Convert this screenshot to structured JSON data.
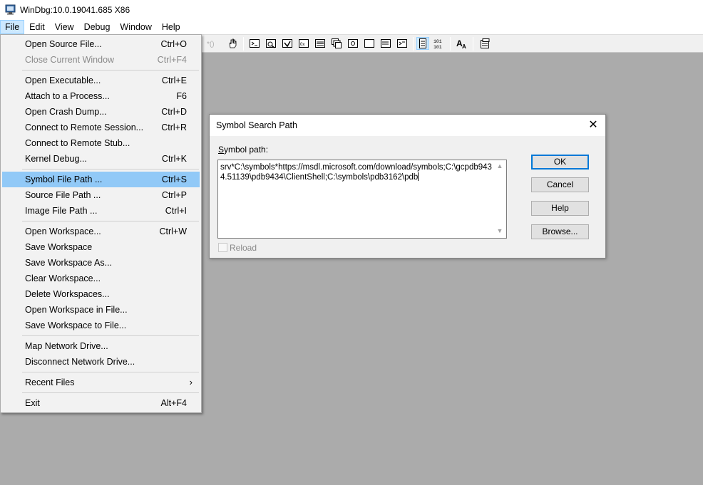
{
  "window": {
    "title": "WinDbg:10.0.19041.685 X86"
  },
  "menubar": {
    "items": [
      "File",
      "Edit",
      "View",
      "Debug",
      "Window",
      "Help"
    ],
    "active": "File"
  },
  "file_menu": {
    "items": [
      {
        "label": "Open Source File...",
        "shortcut": "Ctrl+O",
        "enabled": true
      },
      {
        "label": "Close Current Window",
        "shortcut": "Ctrl+F4",
        "enabled": false
      },
      {
        "label": "Open Executable...",
        "shortcut": "Ctrl+E",
        "enabled": true
      },
      {
        "label": "Attach to a Process...",
        "shortcut": "F6",
        "enabled": true
      },
      {
        "label": "Open Crash Dump...",
        "shortcut": "Ctrl+D",
        "enabled": true
      },
      {
        "label": "Connect to Remote Session...",
        "shortcut": "Ctrl+R",
        "enabled": true
      },
      {
        "label": "Connect to Remote Stub...",
        "shortcut": "",
        "enabled": true
      },
      {
        "label": "Kernel Debug...",
        "shortcut": "Ctrl+K",
        "enabled": true
      },
      {
        "label": "Symbol File Path ...",
        "shortcut": "Ctrl+S",
        "enabled": true,
        "highlighted": true
      },
      {
        "label": "Source File Path ...",
        "shortcut": "Ctrl+P",
        "enabled": true
      },
      {
        "label": "Image File Path ...",
        "shortcut": "Ctrl+I",
        "enabled": true
      },
      {
        "label": "Open Workspace...",
        "shortcut": "Ctrl+W",
        "enabled": true
      },
      {
        "label": "Save Workspace",
        "shortcut": "",
        "enabled": true
      },
      {
        "label": "Save Workspace As...",
        "shortcut": "",
        "enabled": true
      },
      {
        "label": "Clear Workspace...",
        "shortcut": "",
        "enabled": true
      },
      {
        "label": "Delete Workspaces...",
        "shortcut": "",
        "enabled": true
      },
      {
        "label": "Open Workspace in File...",
        "shortcut": "",
        "enabled": true
      },
      {
        "label": "Save Workspace to File...",
        "shortcut": "",
        "enabled": true
      },
      {
        "label": "Map Network Drive...",
        "shortcut": "",
        "enabled": true
      },
      {
        "label": "Disconnect Network Drive...",
        "shortcut": "",
        "enabled": true
      },
      {
        "label": "Recent Files",
        "shortcut": "",
        "enabled": true,
        "submenu": true
      },
      {
        "label": "Exit",
        "shortcut": "Alt+F4",
        "enabled": true
      }
    ]
  },
  "dialog": {
    "title": "Symbol Search Path",
    "close_glyph": "✕",
    "symbol_label": "Symbol path:",
    "symbol_value": "srv*C:\\symbols*https://msdl.microsoft.com/download/symbols;C:\\gcpdb9434.51139\\pdb9434\\ClientShell;C:\\symbols\\pdb3162\\pdb",
    "reload_label": "Reload",
    "reload_checked": false,
    "buttons": {
      "ok": "OK",
      "cancel": "Cancel",
      "help": "Help",
      "browse": "Browse..."
    }
  },
  "colors": {
    "workspace": "#ababab",
    "menu_highlight": "#91c9f7",
    "default_button_border": "#0078d7"
  }
}
